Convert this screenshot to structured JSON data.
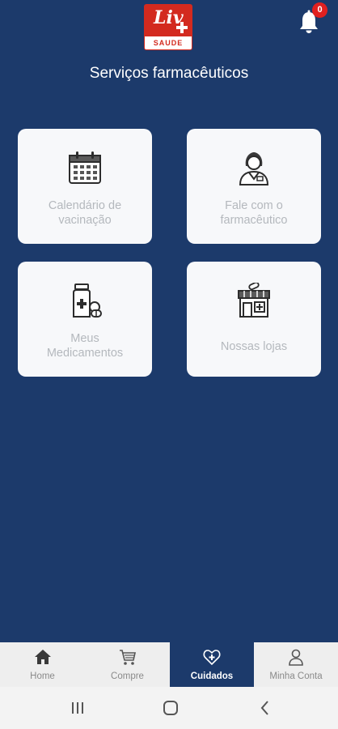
{
  "header": {
    "logo_text": "Liv",
    "logo_sub": "SAUDE",
    "notification_count": "0",
    "title": "Serviços farmacêuticos"
  },
  "cards": [
    {
      "line1": "Calendário de",
      "line2": "vacinação",
      "icon": "calendar-icon"
    },
    {
      "line1": "Fale com o",
      "line2": "farmacêutico",
      "icon": "pharmacist-icon"
    },
    {
      "line1": "Meus",
      "line2": "Medicamentos",
      "icon": "medicine-bottle-icon"
    },
    {
      "line1": "Nossas lojas",
      "icon": "store-icon"
    }
  ],
  "tabs": [
    {
      "label": "Home",
      "icon": "home-icon"
    },
    {
      "label": "Compre",
      "icon": "cart-icon"
    },
    {
      "label": "Cuidados",
      "icon": "heart-health-icon",
      "active": true
    },
    {
      "label": "Minha Conta",
      "icon": "user-icon"
    }
  ],
  "colors": {
    "background": "#1c3a6b",
    "brand_red": "#d32a1f",
    "card_bg": "#f7f8fa",
    "card_text": "#b4b8bd",
    "badge": "#e02020"
  }
}
